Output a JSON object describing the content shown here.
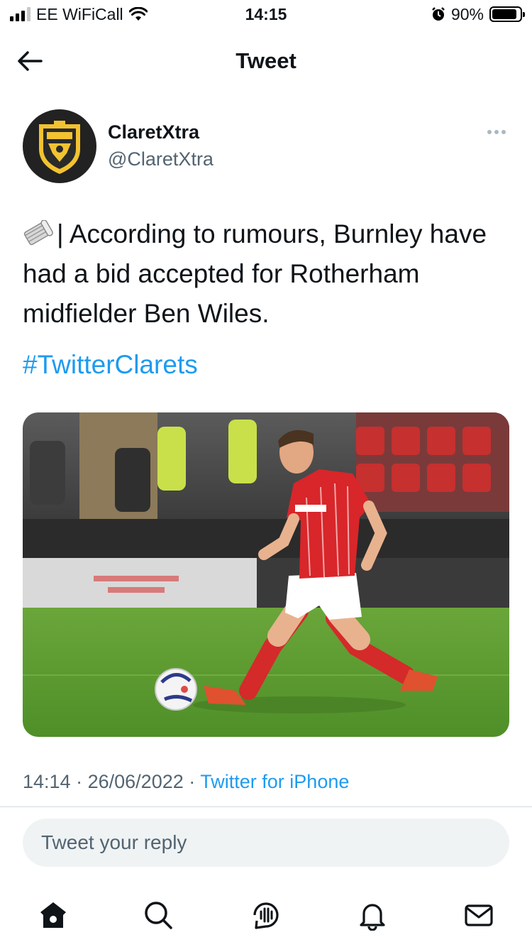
{
  "status_bar": {
    "carrier": "EE WiFiCall",
    "time": "14:15",
    "battery_percent": "90%",
    "battery_level": 0.9
  },
  "header": {
    "title": "Tweet",
    "back_icon": "arrow-left-icon"
  },
  "tweet": {
    "author": {
      "name": "ClaretXtra",
      "handle": "@ClaretXtra"
    },
    "text": "| According to rumours, Burnley have had a bid accepted for Rotherham midfielder Ben Wiles.",
    "hashtag": "#TwitterClarets",
    "time": "14:14",
    "date": "26/06/2022",
    "source": "Twitter for iPhone",
    "sep": "·"
  },
  "reply": {
    "placeholder": "Tweet your reply"
  },
  "tab_bar": {
    "items": [
      "home-icon",
      "search-icon",
      "spaces-icon",
      "notifications-icon",
      "messages-icon"
    ]
  },
  "colors": {
    "accent": "#1d9bf0",
    "secondary_text": "#536471",
    "reply_bg": "#eff3f4"
  }
}
